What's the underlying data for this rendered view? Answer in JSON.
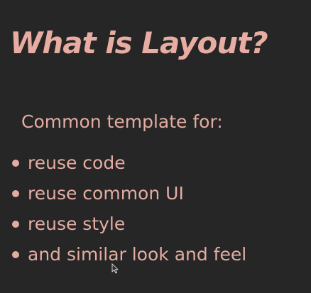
{
  "slide": {
    "title": "What is Layout?",
    "subtitle": "Common template for:",
    "bullets": [
      "reuse code",
      "reuse common UI",
      "reuse style",
      "and similar look and feel"
    ]
  },
  "colors": {
    "background": "#262626",
    "text": "#e3aca2"
  },
  "icons": {
    "cursor": "mouse-pointer-icon",
    "bullet": "bullet-dot-icon"
  }
}
